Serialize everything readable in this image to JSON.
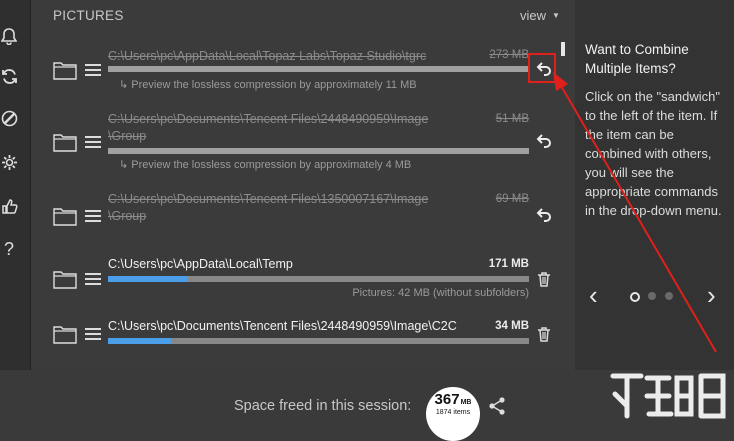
{
  "header": {
    "title": "PICTURES",
    "view_label": "view",
    "caret": "▼"
  },
  "items": [
    {
      "path": "C:\\Users\\pc\\AppData\\Local\\Topaz Labs\\Topaz Studio\\tgrc",
      "size": "273 MB",
      "note": "↳ Preview the lossless compression by approximately 11 MB",
      "progress": 1.0,
      "done": true
    },
    {
      "path": "C:\\Users\\pc\\Documents\\Tencent Files\\2448490959\\Image\n\\Group",
      "size": "51 MB",
      "note": "↳ Preview the lossless compression by approximately 4 MB",
      "progress": 1.0,
      "done": true
    },
    {
      "path": "C:\\Users\\pc\\Documents\\Tencent Files\\1350007167\\Image\n\\Group",
      "size": "69 MB",
      "note": "",
      "progress": 1.0,
      "done": true
    },
    {
      "path": "C:\\Users\\pc\\AppData\\Local\\Temp",
      "size": "171 MB",
      "note": "Pictures: 42 MB (without subfolders)",
      "progress": 0.19,
      "done": false
    },
    {
      "path": "C:\\Users\\pc\\Documents\\Tencent Files\\2448490959\\Image\\C2C",
      "size": "34 MB",
      "note": "",
      "progress": 0.15,
      "done": false
    }
  ],
  "tip": {
    "title": "Want to Combine Multiple Items?",
    "body": "Click on the \"sandwich\" to the left of the item. If the item can be combined with others, you will see the appropriate commands in the drop-down menu."
  },
  "carousel": {
    "prev": "‹",
    "next": "›",
    "active_index": 0
  },
  "footer": {
    "freed_label": "Space freed in this session:",
    "freed_value": "367",
    "freed_unit": "MB",
    "freed_items": "1874 items"
  },
  "colors": {
    "accent": "#4a9fe8",
    "highlight": "#e0201a",
    "done_bar": "#a0a0a0"
  }
}
